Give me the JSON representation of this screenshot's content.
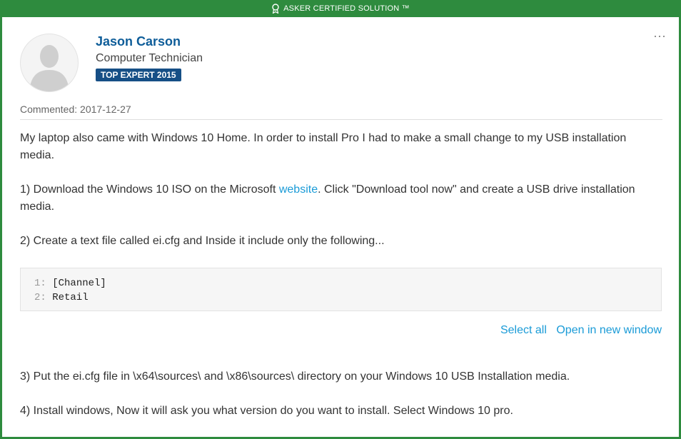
{
  "banner": {
    "text": "ASKER CERTIFIED SOLUTION ™",
    "icon": "ribbon-icon"
  },
  "author": {
    "name": "Jason Carson",
    "title": "Computer Technician",
    "badge": "TOP EXPERT 2015",
    "avatar": "user-silhouette-icon"
  },
  "menu_icon": "⋯",
  "meta": {
    "commented": "Commented: 2017-12-27"
  },
  "body": {
    "p1": "My laptop also came with Windows 10 Home. In order to install Pro I had to make a small change to my USB installation media.",
    "p2_before": "1) Download the Windows 10 ISO on the Microsoft ",
    "p2_link": "website",
    "p2_after": ". Click \"Download tool now\" and create a USB drive installation media.",
    "p3": "2) Create a text file called ei.cfg and Inside it include only the following...",
    "p4": "3) Put the ei.cfg file in \\x64\\sources\\ and \\x86\\sources\\ directory on your Windows 10 USB Installation media.",
    "p5": "4) Install windows, Now it will ask you what version do you want to install. Select Windows 10 pro."
  },
  "code": {
    "lines": [
      {
        "num": "1:",
        "text": "[Channel]"
      },
      {
        "num": "2:",
        "text": "Retail"
      }
    ]
  },
  "code_actions": {
    "select_all": "Select all",
    "open_window": "Open in new window"
  },
  "colors": {
    "accent": "#2e8b3e",
    "link": "#1a9bd7",
    "name": "#0e5d99",
    "badge": "#164f86"
  }
}
